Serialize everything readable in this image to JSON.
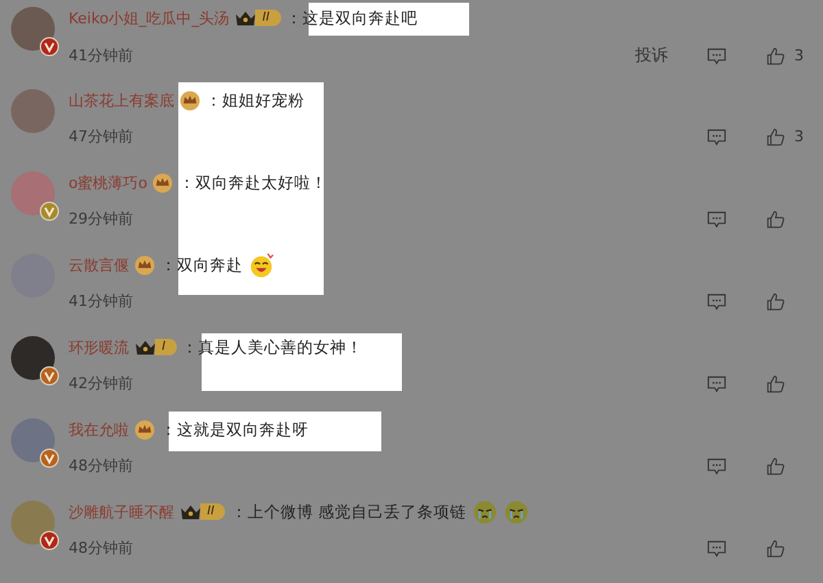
{
  "comments": [
    {
      "name": "Keiko小姐_吃瓜中_头汤",
      "badge": {
        "kind": "level",
        "text": "II"
      },
      "text": "：这是双向奔赴吧",
      "time": "41分钟前",
      "verified": {
        "color": "#b3261a"
      },
      "report": "投诉",
      "likes": "3"
    },
    {
      "name": "山茶花上有案底",
      "badge": {
        "kind": "round"
      },
      "text": "：姐姐好宠粉",
      "time": "47分钟前",
      "likes": "3"
    },
    {
      "name": "o蜜桃薄巧o",
      "badge": {
        "kind": "round"
      },
      "text": "：双向奔赴太好啦！",
      "time": "29分钟前",
      "verified": {
        "color": "#a88a2a"
      }
    },
    {
      "name": "云散言偃",
      "badge": {
        "kind": "round"
      },
      "text": "：双向奔赴",
      "time": "41分钟前",
      "emojis": [
        {
          "kind": "grin"
        }
      ]
    },
    {
      "name": "环形暖流",
      "badge": {
        "kind": "level",
        "text": "I"
      },
      "text": "：真是人美心善的女神！",
      "time": "42分钟前",
      "verified": {
        "color": "#b8621e"
      }
    },
    {
      "name": "我在允啦",
      "badge": {
        "kind": "round"
      },
      "text": "：这就是双向奔赴呀",
      "time": "48分钟前",
      "verified": {
        "color": "#b8621e"
      }
    },
    {
      "name": "沙雕航子睡不醒",
      "badge": {
        "kind": "level",
        "text": "II"
      },
      "text": "：上个微博 感觉自己丢了条项链",
      "time": "48分钟前",
      "verified": {
        "color": "#b3261a"
      },
      "emojis": [
        {
          "kind": "cry"
        },
        {
          "kind": "cry"
        }
      ]
    }
  ]
}
